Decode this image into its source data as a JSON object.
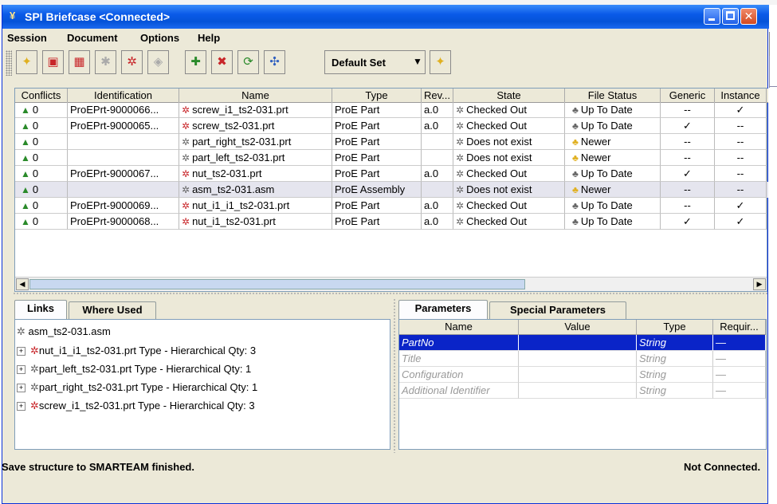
{
  "window": {
    "title": "SPI Briefcase <Connected>"
  },
  "menu": [
    "Session",
    "Document",
    "Options",
    "Help"
  ],
  "toolbar": {
    "set_label": "Default Set"
  },
  "table": {
    "columns": [
      "Conflicts",
      "Identification",
      "Name",
      "Type",
      "Rev...",
      "State",
      "File Status",
      "Generic",
      "Instance"
    ],
    "rows": [
      {
        "conflicts": "0",
        "id": "ProEPrt-9000066...",
        "name": "screw_i1_ts2-031.prt",
        "type": "ProE Part",
        "rev": "a.0",
        "state": "Checked Out",
        "status": "Up To Date",
        "generic": "--",
        "instance": "✓",
        "icon": "red"
      },
      {
        "conflicts": "0",
        "id": "ProEPrt-9000065...",
        "name": "screw_ts2-031.prt",
        "type": "ProE Part",
        "rev": "a.0",
        "state": "Checked Out",
        "status": "Up To Date",
        "generic": "✓",
        "instance": "--",
        "icon": "red"
      },
      {
        "conflicts": "0",
        "id": "",
        "name": "part_right_ts2-031.prt",
        "type": "ProE Part",
        "rev": "",
        "state": "Does not exist",
        "status": "Newer",
        "generic": "--",
        "instance": "--",
        "icon": "gray"
      },
      {
        "conflicts": "0",
        "id": "",
        "name": "part_left_ts2-031.prt",
        "type": "ProE Part",
        "rev": "",
        "state": "Does not exist",
        "status": "Newer",
        "generic": "--",
        "instance": "--",
        "icon": "gray"
      },
      {
        "conflicts": "0",
        "id": "ProEPrt-9000067...",
        "name": "nut_ts2-031.prt",
        "type": "ProE Part",
        "rev": "a.0",
        "state": "Checked Out",
        "status": "Up To Date",
        "generic": "✓",
        "instance": "--",
        "icon": "red"
      },
      {
        "conflicts": "0",
        "id": "",
        "name": "asm_ts2-031.asm",
        "type": "ProE Assembly",
        "rev": "",
        "state": "Does not exist",
        "status": "Newer",
        "generic": "--",
        "instance": "--",
        "icon": "gray"
      },
      {
        "conflicts": "0",
        "id": "ProEPrt-9000069...",
        "name": "nut_i1_i1_ts2-031.prt",
        "type": "ProE Part",
        "rev": "a.0",
        "state": "Checked Out",
        "status": "Up To Date",
        "generic": "--",
        "instance": "✓",
        "icon": "red"
      },
      {
        "conflicts": "0",
        "id": "ProEPrt-9000068...",
        "name": "nut_i1_ts2-031.prt",
        "type": "ProE Part",
        "rev": "a.0",
        "state": "Checked Out",
        "status": "Up To Date",
        "generic": "✓",
        "instance": "✓",
        "icon": "red"
      }
    ]
  },
  "links_tabs": [
    "Links",
    "Where Used"
  ],
  "tree": {
    "root": "asm_ts2-031.asm",
    "children": [
      "nut_i1_i1_ts2-031.prt Type - Hierarchical Qty: 3",
      "part_left_ts2-031.prt Type - Hierarchical Qty: 1",
      "part_right_ts2-031.prt Type - Hierarchical Qty: 1",
      "screw_i1_ts2-031.prt Type - Hierarchical Qty: 3"
    ],
    "child_icons": [
      "red",
      "gray",
      "gray",
      "red"
    ]
  },
  "param_tabs": [
    "Parameters",
    "Special Parameters"
  ],
  "params": {
    "columns": [
      "Name",
      "Value",
      "Type",
      "Requir..."
    ],
    "rows": [
      {
        "name": "PartNo",
        "value": "",
        "type": "String",
        "req": "—"
      },
      {
        "name": "Title",
        "value": "",
        "type": "String",
        "req": "—"
      },
      {
        "name": "Configuration",
        "value": "",
        "type": "String",
        "req": "—"
      },
      {
        "name": "Additional Identifier",
        "value": "",
        "type": "String",
        "req": "—"
      }
    ]
  },
  "status": {
    "left": "Save structure to SMARTEAM finished.",
    "right": "Not Connected."
  }
}
